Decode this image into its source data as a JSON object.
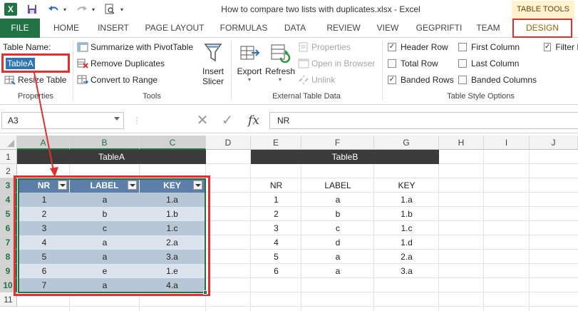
{
  "app": {
    "title": "How to compare two lists with duplicates.xlsx - Excel",
    "logo": "X",
    "contextual_group": "TABLE TOOLS"
  },
  "qat": {
    "save_icon": "save-icon",
    "undo_icon": "undo-icon",
    "redo_icon": "redo-icon",
    "preview_icon": "print-preview-icon"
  },
  "tabs": [
    "FILE",
    "HOME",
    "INSERT",
    "PAGE LAYOUT",
    "FORMULAS",
    "DATA",
    "REVIEW",
    "VIEW",
    "GEGPRIFTI",
    "TEAM",
    "DESIGN"
  ],
  "ribbon": {
    "properties": {
      "table_name_label": "Table Name:",
      "table_name_value": "TableA",
      "resize": "Resize Table",
      "group": "Properties"
    },
    "tools": {
      "summarize": "Summarize with PivotTable",
      "remove_dupes": "Remove Duplicates",
      "convert": "Convert to Range",
      "insert_slicer_1": "Insert",
      "insert_slicer_2": "Slicer",
      "group": "Tools"
    },
    "external": {
      "export": "Export",
      "refresh": "Refresh",
      "properties": "Properties",
      "open_browser": "Open in Browser",
      "unlink": "Unlink",
      "group": "External Table Data"
    },
    "style_options": {
      "header_row": "Header Row",
      "total_row": "Total Row",
      "banded_rows": "Banded Rows",
      "first_column": "First Column",
      "last_column": "Last Column",
      "banded_columns": "Banded Columns",
      "filter_button": "Filter B",
      "group": "Table Style Options",
      "checked": {
        "header_row": true,
        "total_row": false,
        "banded_rows": true,
        "first_column": false,
        "last_column": false,
        "banded_columns": false,
        "filter_button": true
      }
    }
  },
  "formula_bar": {
    "name_box": "A3",
    "fx": "fx",
    "formula": "NR"
  },
  "grid": {
    "columns": [
      "A",
      "B",
      "C",
      "D",
      "E",
      "F",
      "G",
      "H",
      "I",
      "J"
    ],
    "rows": [
      "1",
      "2",
      "3",
      "4",
      "5",
      "6",
      "7",
      "8",
      "9",
      "10",
      "11"
    ],
    "tableA": {
      "title": "TableA",
      "headers": [
        "NR",
        "LABEL",
        "KEY"
      ],
      "rows": [
        [
          "1",
          "a",
          "1.a"
        ],
        [
          "2",
          "b",
          "1.b"
        ],
        [
          "3",
          "c",
          "1.c"
        ],
        [
          "4",
          "a",
          "2.a"
        ],
        [
          "5",
          "a",
          "3.a"
        ],
        [
          "6",
          "e",
          "1.e"
        ],
        [
          "7",
          "a",
          "4.a"
        ]
      ]
    },
    "tableB": {
      "title": "TableB",
      "headers": [
        "NR",
        "LABEL",
        "KEY"
      ],
      "rows": [
        [
          "1",
          "a",
          "1.a"
        ],
        [
          "2",
          "b",
          "1.b"
        ],
        [
          "3",
          "c",
          "1.c"
        ],
        [
          "4",
          "d",
          "1.d"
        ],
        [
          "5",
          "a",
          "2.a"
        ],
        [
          "6",
          "a",
          "3.a"
        ]
      ]
    }
  },
  "colors": {
    "excel_green": "#217346",
    "highlight_red": "#e23030",
    "table_header": "#5b7fa8",
    "band_dark": "#b8c7d6",
    "band_light": "#dbe3ec",
    "title_dark": "#3b3b3b"
  }
}
